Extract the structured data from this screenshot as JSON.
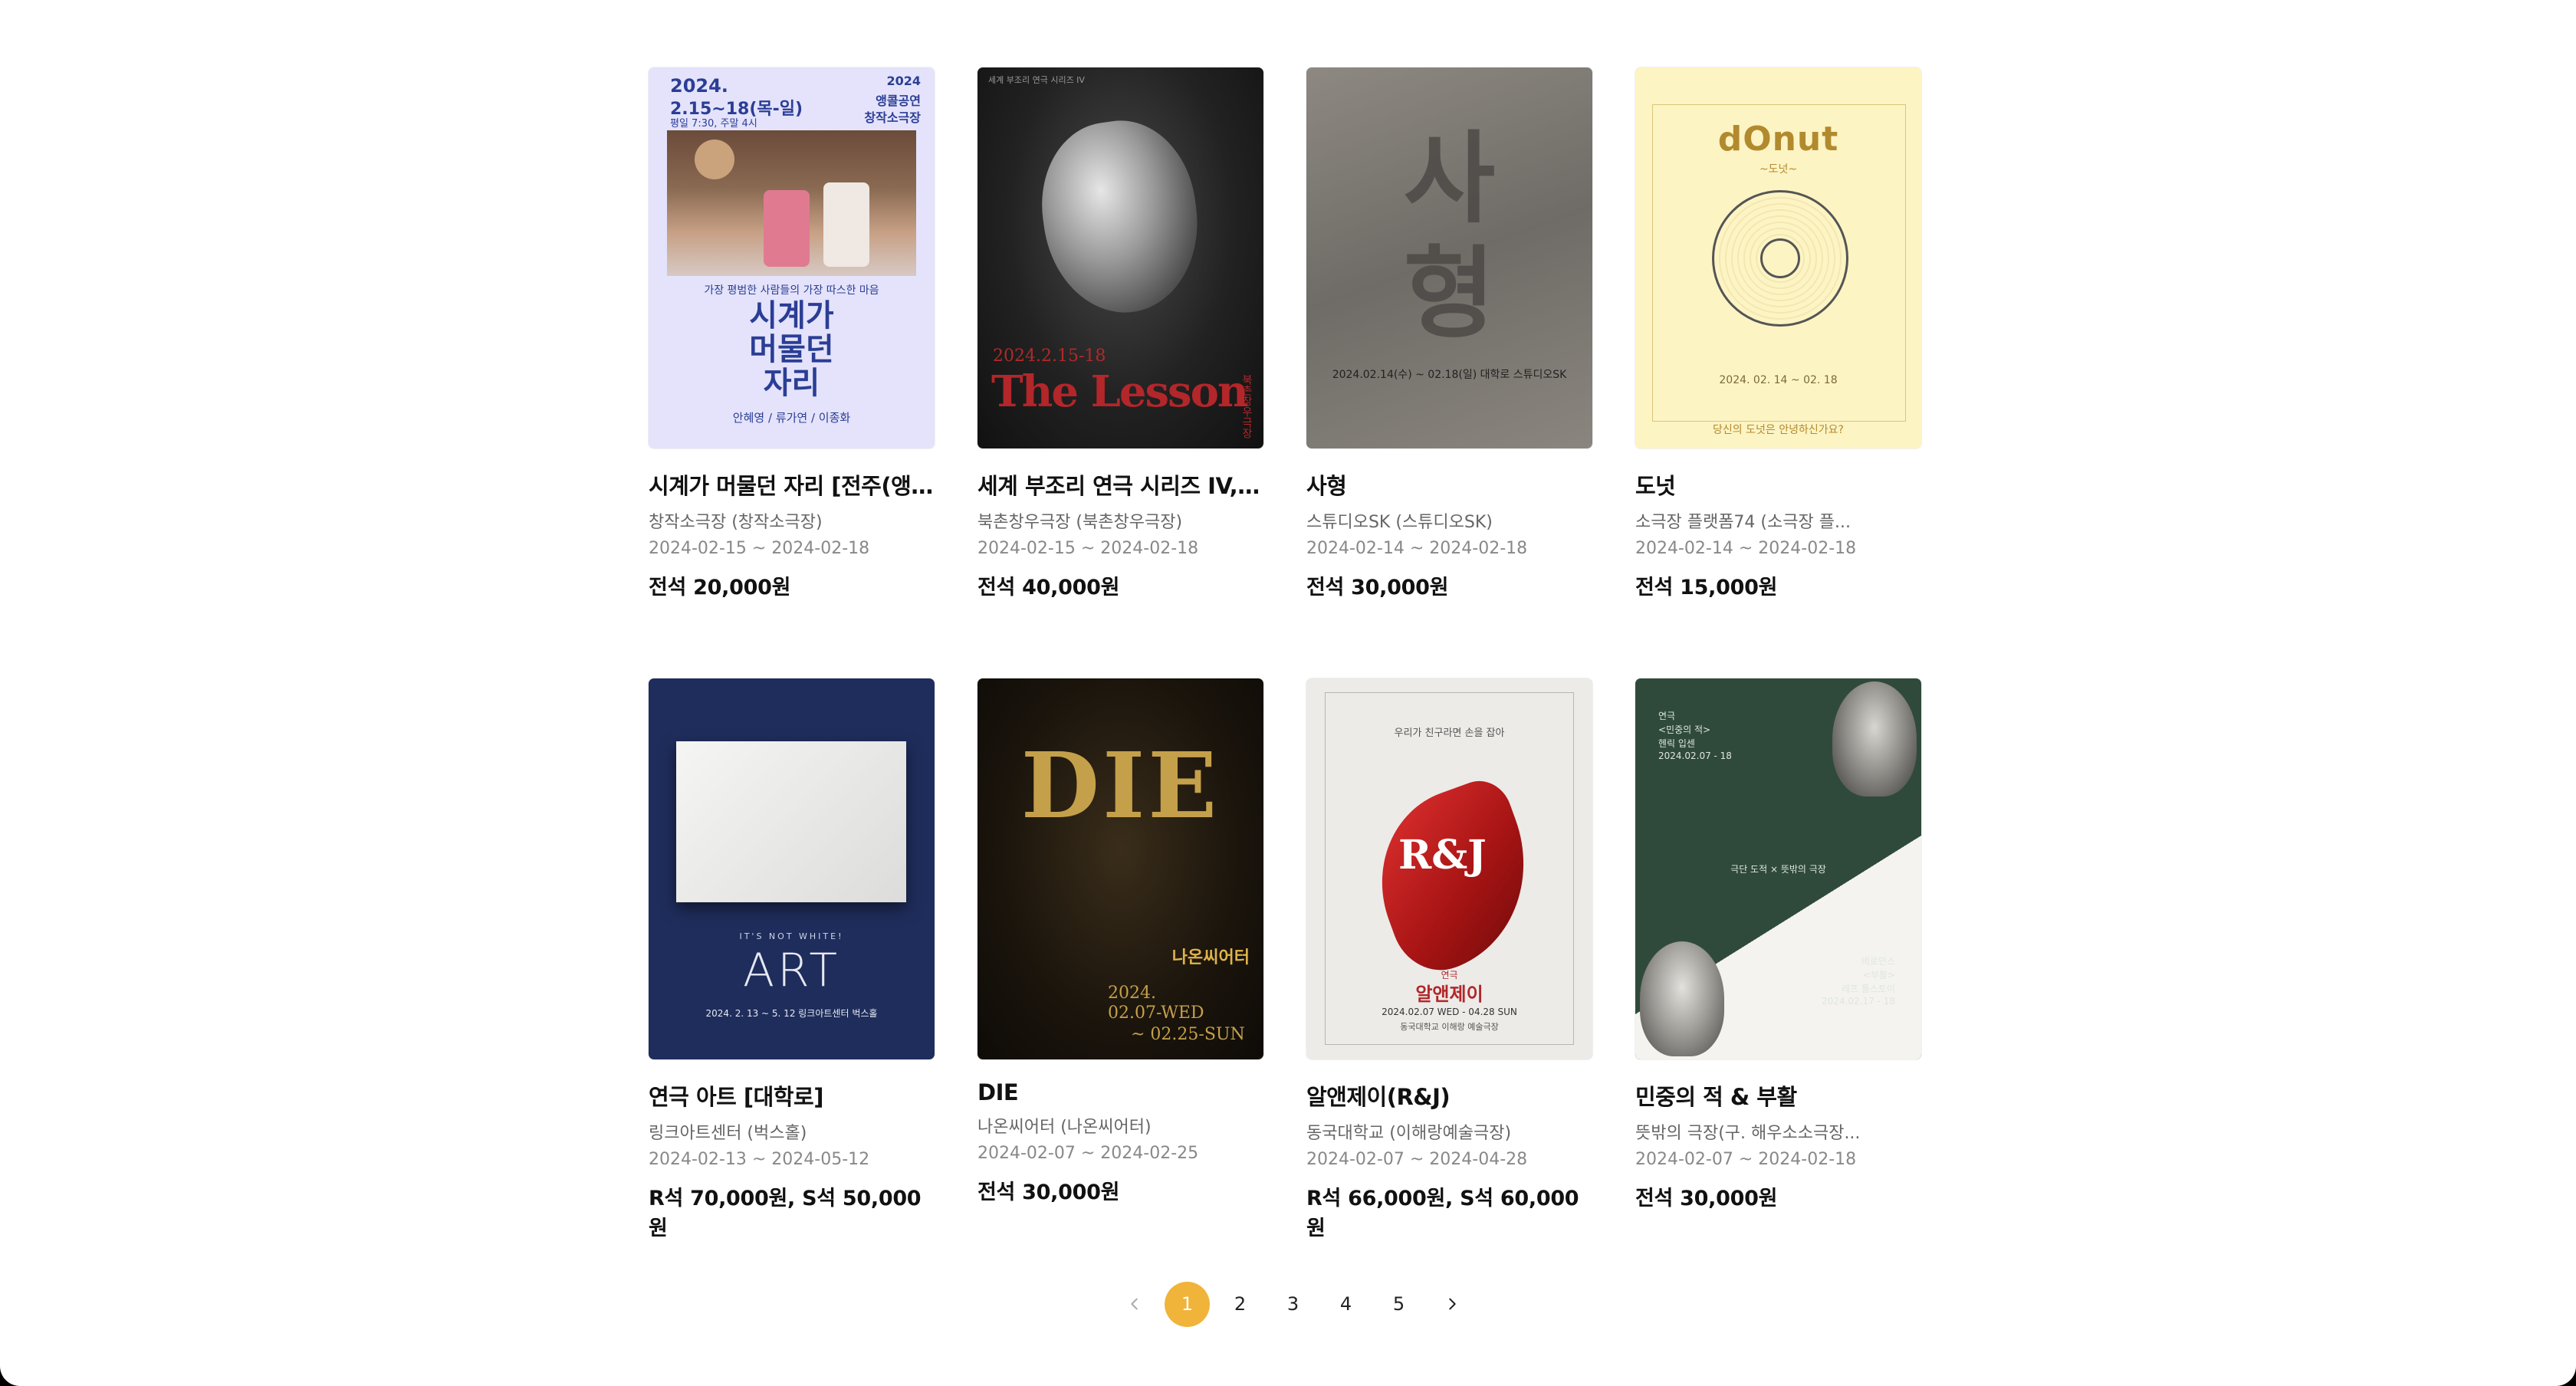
{
  "colors": {
    "accent": "#f0b43a",
    "page_bg": "#ffffff",
    "frame_bg": "#000000"
  },
  "shows": [
    {
      "title": "시계가 머물던 자리 [전주(앵콜)]",
      "venue": "창작소극장 (창작소극장)",
      "dates": "2024-02-15 ~ 2024-02-18",
      "price": "전석 20,000원",
      "poster": {
        "year": "2024.",
        "dates": "2.15~18(목-일)",
        "times": "평일 7:30, 주말 4시",
        "badge_year": "2024",
        "badge_1": "앵콜공연",
        "badge_2": "창작소극장",
        "tagline": "가장 평범한 사람들의 가장 따스한 마음",
        "title_1": "시계가",
        "title_2": "머물던",
        "title_3": "자리",
        "cast": "안혜영 / 류가연 / 이종화"
      }
    },
    {
      "title": "세계 부조리 연극 시리즈 IV, 수업",
      "venue": "북촌창우극장 (북촌창우극장)",
      "dates": "2024-02-15 ~ 2024-02-18",
      "price": "전석 40,000원",
      "poster": {
        "header": "세계 부조리 연극 시리즈 IV",
        "date": "2024.2.15-18",
        "title": "The Lesson",
        "side": "북촌창우극장"
      }
    },
    {
      "title": "사형",
      "venue": "스튜디오SK (스튜디오SK)",
      "dates": "2024-02-14 ~ 2024-02-18",
      "price": "전석 30,000원",
      "poster": {
        "char_1": "사",
        "char_2": "형",
        "info": "2024.02.14(수) ~ 02.18(일)  대학로 스튜디오SK"
      }
    },
    {
      "title": "도넛",
      "venue": "소극장 플랫폼74 (소극장 플...",
      "dates": "2024-02-14 ~ 2024-02-18",
      "price": "전석 15,000원",
      "poster": {
        "title": "dOnut",
        "subtitle": "~도넛~",
        "date": "2024. 02. 14 ~ 02. 18",
        "footer": "당신의 도넛은 안녕하신가요?"
      }
    },
    {
      "title": "연극 아트 [대학로]",
      "venue": "링크아트센터 (벅스홀)",
      "dates": "2024-02-13 ~ 2024-05-12",
      "price": "R석 70,000원, S석 50,000원",
      "poster": {
        "tag": "IT'S NOT WHITE!",
        "title": "ART",
        "date": "2024. 2. 13 ~ 5. 12  링크아트센터 벅스홀"
      }
    },
    {
      "title": "DIE",
      "venue": "나온씨어터 (나온씨어터)",
      "dates": "2024-02-07 ~ 2024-02-25",
      "price": "전석 30,000원",
      "poster": {
        "title": "DIE",
        "venue": "나온씨어터",
        "date_1": "2024.",
        "date_2": "02.07-WED",
        "date_3": "~ 02.25-SUN"
      }
    },
    {
      "title": "알앤제이(R&J)",
      "venue": "동국대학교 (이해랑예술극장)",
      "dates": "2024-02-07 ~ 2024-04-28",
      "price": "R석 66,000원, S석 60,000원",
      "poster": {
        "tagline": "우리가 친구라면 손을 잡아",
        "logo": "R&J",
        "title_small": "연극",
        "title": "알앤제이",
        "date": "2024.02.07 WED - 04.28 SUN",
        "venue": "동국대학교 이해랑 예술극장"
      }
    },
    {
      "title": "민중의 적 & 부활",
      "venue": "뜻밖의 극장(구. 해우소소극장...",
      "dates": "2024-02-07 ~ 2024-02-18",
      "price": "전석 30,000원",
      "poster": {
        "line_1": "연극",
        "line_2": "<민중의 적>",
        "line_3": "헨릭 입센",
        "line_4": "2024.02.07 - 18",
        "line_5": "극단 도적 × 뜻밖의 극장",
        "line_6": "비로인스",
        "line_7": "<부활>",
        "line_8": "레프 톨스토이",
        "line_9": "2024.02.17 - 18"
      }
    }
  ],
  "pagination": {
    "pages": [
      "1",
      "2",
      "3",
      "4",
      "5"
    ],
    "current": "1"
  }
}
